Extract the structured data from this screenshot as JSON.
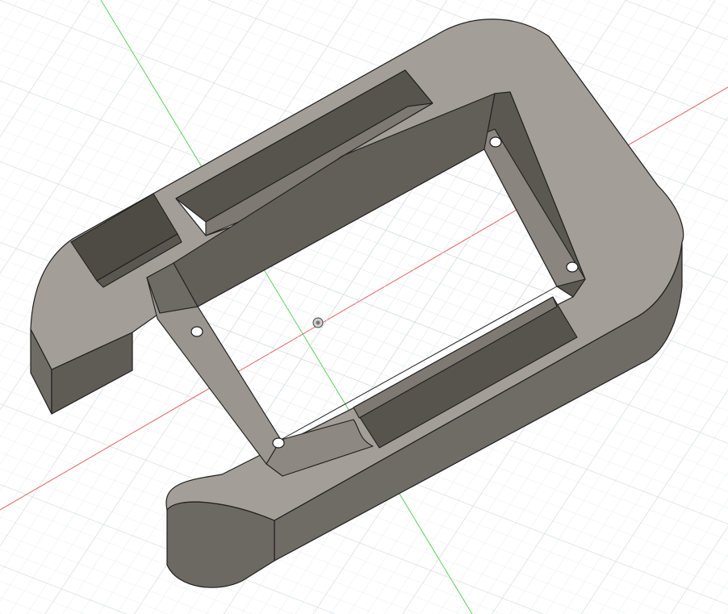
{
  "app": {
    "view": "3d-viewport",
    "object": "machined-frame-part"
  },
  "grid": {
    "visible": true
  },
  "axes": {
    "x_color": "#e06060",
    "y_color": "#5ccf5c"
  },
  "colors": {
    "background": "#ffffff",
    "grid_minor": "#e4e7ea",
    "grid_major": "#cfd4d8",
    "top_face": "#a39f98",
    "side_face": "#6f6c66",
    "inner_wall": "#59564f",
    "pocket_floor": "#8f8b84",
    "edge": "#1f1f1f"
  },
  "icons": {
    "origin": "origin-marker-icon",
    "hole": "screw-hole-icon"
  }
}
